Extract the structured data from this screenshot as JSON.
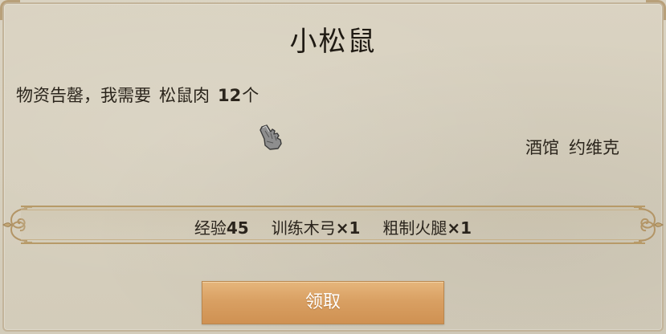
{
  "dialog": {
    "title": "小松鼠",
    "message": {
      "prefix": "物资告罄，我需要",
      "item": "松鼠肉",
      "quantity": "12",
      "unit": "个"
    },
    "giver": {
      "location": "酒馆",
      "name": "约维克"
    },
    "rewards": [
      {
        "label": "经验",
        "value": "45"
      },
      {
        "label": "训练木弓",
        "value": "×1"
      },
      {
        "label": "粗制火腿",
        "value": "×1"
      }
    ],
    "claim_button": "领取"
  },
  "icons": {
    "cursor": "gauntlet-hand-cursor-icon"
  },
  "colors": {
    "parchment": "#d8d1bf",
    "button": "#d9a063",
    "border_gold": "#b79a68",
    "text": "#2a241c"
  }
}
